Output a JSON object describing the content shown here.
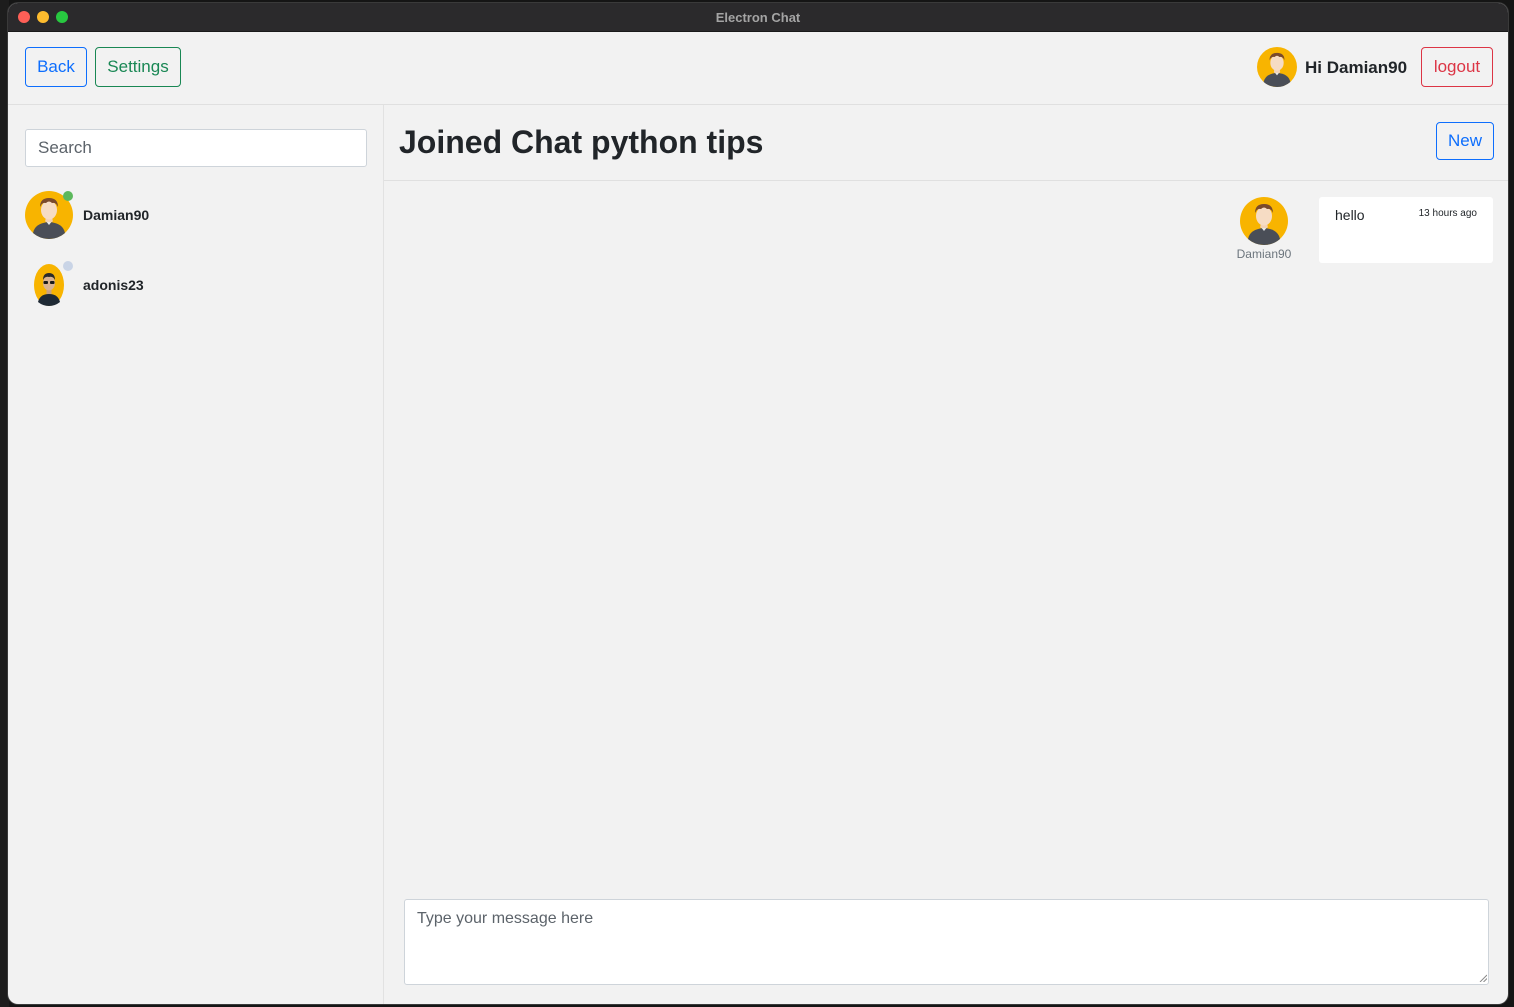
{
  "window": {
    "title": "Electron Chat"
  },
  "topbar": {
    "back_label": "Back",
    "settings_label": "Settings",
    "greeting": "Hi Damian90",
    "logout_label": "logout"
  },
  "sidebar": {
    "search_placeholder": "Search",
    "users": [
      {
        "name": "Damian90",
        "status": "online",
        "status_color": "#5cb85c",
        "avatar": "man-avatar-icon"
      },
      {
        "name": "adonis23",
        "status": "offline",
        "status_color": "#c9d4e6",
        "avatar": "sunglasses-avatar-icon"
      }
    ]
  },
  "chat": {
    "title": "Joined Chat python tips",
    "new_label": "New",
    "messages": [
      {
        "author": "Damian90",
        "text": "hello",
        "time": "13 hours ago"
      }
    ],
    "composer_placeholder": "Type your message here"
  },
  "colors": {
    "primary": "#0d6efd",
    "success": "#198754",
    "danger": "#dc3545",
    "avatar_bg": "#f8b400"
  }
}
